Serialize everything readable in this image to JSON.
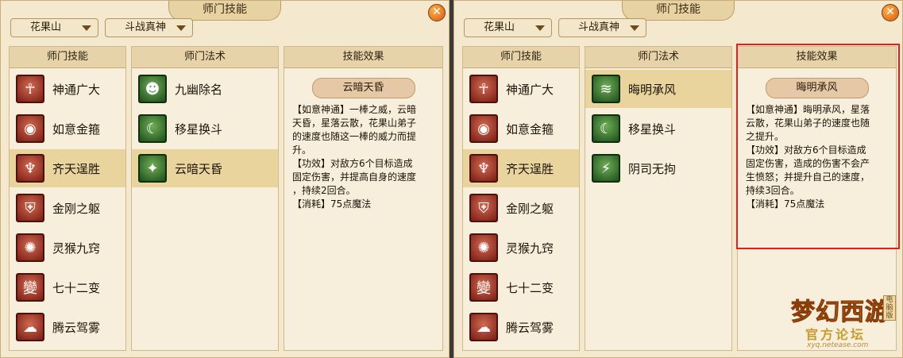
{
  "panels": [
    {
      "title": "师门技能",
      "dropdown1": "花果山",
      "dropdown2": "斗战真神",
      "skills_header": "师门技能",
      "spells_header": "师门法术",
      "effect_header": "技能效果",
      "skills": [
        {
          "label": "神通广大",
          "icon": "shentong-icon"
        },
        {
          "label": "如意金箍",
          "icon": "jingu-icon"
        },
        {
          "label": "齐天逞胜",
          "icon": "qitian-icon"
        },
        {
          "label": "金刚之躯",
          "icon": "jingang-icon"
        },
        {
          "label": "灵猴九窍",
          "icon": "linghou-icon"
        },
        {
          "label": "七十二变",
          "icon": "bian-icon"
        },
        {
          "label": "腾云驾雾",
          "icon": "cloud-icon"
        }
      ],
      "selected_skill": 2,
      "spells": [
        {
          "label": "九幽除名",
          "icon": "jiuyou-icon"
        },
        {
          "label": "移星换斗",
          "icon": "star-moon-icon"
        },
        {
          "label": "云暗天昏",
          "icon": "yunan-icon"
        }
      ],
      "selected_spell": 2,
      "effect_title": "云暗天昏",
      "effect_lines": [
        "【如意神通】一棒之威，云暗",
        "天昏，星落云散，花果山弟子",
        "的速度也随这一棒的威力而提",
        "升。",
        "【功效】对敌方6个目标造成",
        "固定伤害，并提高自身的速度",
        "，持续2回合。",
        "【消耗】75点魔法"
      ]
    },
    {
      "title": "师门技能",
      "dropdown1": "花果山",
      "dropdown2": "斗战真神",
      "skills_header": "师门技能",
      "spells_header": "师门法术",
      "effect_header": "技能效果",
      "skills": [
        {
          "label": "神通广大",
          "icon": "shentong-icon"
        },
        {
          "label": "如意金箍",
          "icon": "jingu-icon"
        },
        {
          "label": "齐天逞胜",
          "icon": "qitian-icon"
        },
        {
          "label": "金刚之躯",
          "icon": "jingang-icon"
        },
        {
          "label": "灵猴九窍",
          "icon": "linghou-icon"
        },
        {
          "label": "七十二变",
          "icon": "bian-icon"
        },
        {
          "label": "腾云驾雾",
          "icon": "cloud-icon"
        }
      ],
      "selected_skill": 2,
      "spells": [
        {
          "label": "晦明承风",
          "icon": "wind-icon"
        },
        {
          "label": "移星换斗",
          "icon": "star-moon-icon"
        },
        {
          "label": "阴司无拘",
          "icon": "yinsi-icon"
        }
      ],
      "selected_spell": 0,
      "effect_title": "晦明承风",
      "effect_lines": [
        "【如意神通】晦明承风，星落",
        "云散，花果山弟子的速度也随",
        "之提升。",
        "【功效】对敌方6个目标造成",
        "固定伤害，造成的伤害不会产",
        "生愤怒；并提升自己的速度，",
        "持续3回合。",
        "【消耗】75点魔法"
      ]
    }
  ],
  "close_glyph": "✕",
  "skill_glyphs": [
    "☥",
    "◉",
    "♆",
    "⛨",
    "✺",
    "變",
    "☁"
  ],
  "logo": {
    "main": "梦幻西游",
    "sub": "官方论坛",
    "url": "xyq.netease.com",
    "version": "电脑版"
  },
  "colors": {
    "highlight": "#e0201c",
    "selected_row": "#e9d49e",
    "panel_bg": "#f4e9cf"
  }
}
